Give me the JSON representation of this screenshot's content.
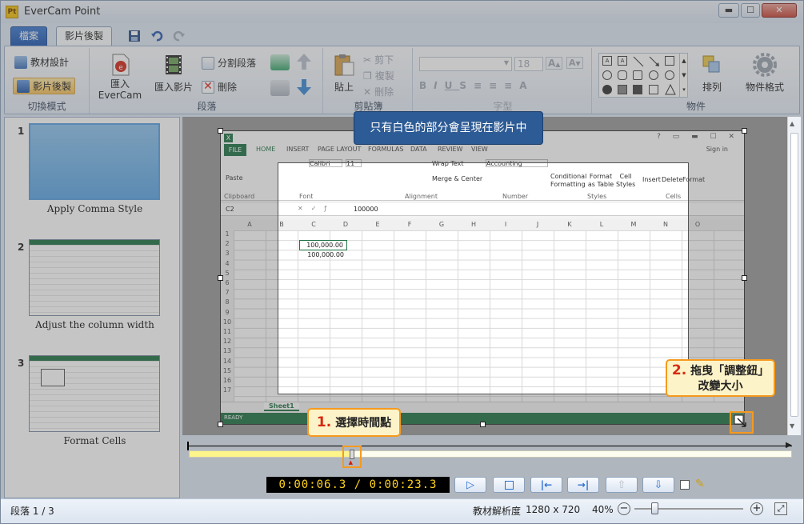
{
  "window": {
    "title": "EverCam Point",
    "logo_text": "Pt",
    "minimize": "▬",
    "maximize": "☐",
    "close": "✕"
  },
  "tabs": {
    "file": "檔案",
    "video_edit": "影片後製"
  },
  "ribbon": {
    "switch_mode": {
      "label": "切換模式",
      "material_design": "教材設計",
      "video_edit": "影片後製"
    },
    "segment": {
      "label": "段落",
      "import_evercam_line1": "匯入",
      "import_evercam_line2": "EverCam",
      "import_video": "匯入影片",
      "split": "分割段落",
      "delete": "刪除"
    },
    "clipboard": {
      "label": "剪貼簿",
      "paste": "貼上",
      "cut": "剪下",
      "copy": "複製",
      "delete": "刪除"
    },
    "font": {
      "label": "字型",
      "size": "18"
    },
    "object": {
      "label": "物件",
      "arrange": "排列",
      "format": "物件格式"
    }
  },
  "slides": [
    {
      "num": "1",
      "caption": "Apply Comma Style"
    },
    {
      "num": "2",
      "caption": "Adjust the column width"
    },
    {
      "num": "3",
      "caption": "Format Cells"
    }
  ],
  "excel": {
    "tabs": [
      "FILE",
      "HOME",
      "INSERT",
      "PAGE LAYOUT",
      "FORMULAS",
      "DATA",
      "REVIEW",
      "VIEW"
    ],
    "signin": "Sign in",
    "cell_ref": "C2",
    "formula": "100000",
    "columns": [
      "A",
      "B",
      "C",
      "D",
      "E",
      "F",
      "G",
      "H",
      "I",
      "J",
      "K",
      "L",
      "M",
      "N",
      "O"
    ],
    "rows": [
      "1",
      "2",
      "3",
      "4",
      "5",
      "6",
      "7",
      "8",
      "9",
      "10",
      "11",
      "12",
      "13",
      "14",
      "15",
      "16",
      "17"
    ],
    "cell_c2": "100,000.00",
    "cell_c3": "100,000.00",
    "sheet": "Sheet1",
    "status": "READY",
    "ribbon_groups": [
      "Clipboard",
      "Font",
      "Alignment",
      "Number",
      "Styles",
      "Cells"
    ],
    "wrap_text": "Wrap Text",
    "merge_center": "Merge & Center",
    "number_format": "Accounting",
    "conditional": "Conditional Formatting",
    "format_as_table": "Format as Table",
    "cell_styles": "Cell Styles",
    "insert": "Insert",
    "delete": "Delete",
    "format": "Format",
    "font_name": "Calibri",
    "font_size": "11",
    "paste": "Paste"
  },
  "callouts": {
    "tip": "只有白色的部分會呈現在影片中",
    "step1_num": "1.",
    "step1_text": "選擇時間點",
    "step2_num": "2.",
    "step2_text_line1": "拖曳「調整鈕」",
    "step2_text_line2": "改變大小"
  },
  "player": {
    "timecode": "0:00:06.3 / 0:00:23.3",
    "progress": 0.27
  },
  "status": {
    "segment": "段落 1 / 3",
    "resolution_label": "教材解析度",
    "resolution": "1280 x 720",
    "zoom": "40%"
  }
}
